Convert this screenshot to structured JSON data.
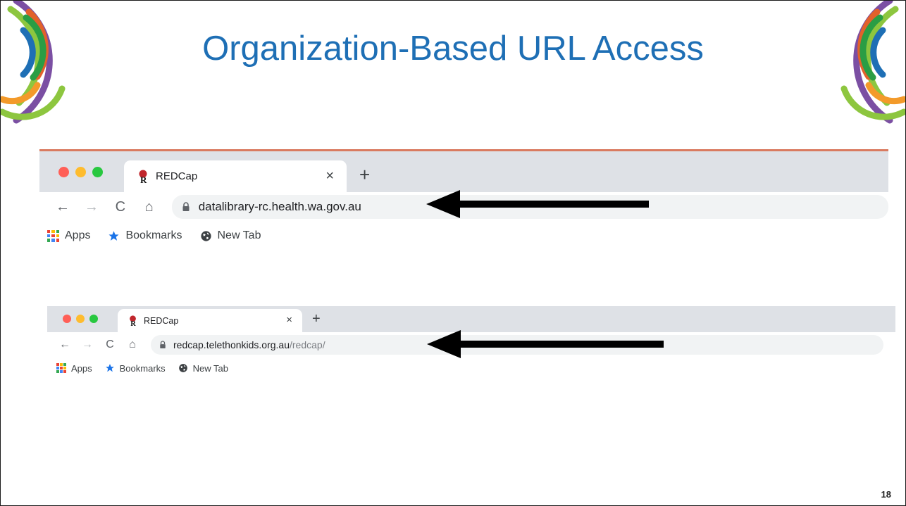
{
  "slide": {
    "title": "Organization-Based URL Access",
    "page_number": "18",
    "decor_colors": [
      "#7b4fa3",
      "#e2612b",
      "#2a9d44",
      "#f39a2a",
      "#1e6fb5",
      "#8dc63f"
    ]
  },
  "browser1": {
    "traffic_lights": [
      "#ff5f57",
      "#febc2e",
      "#28c840"
    ],
    "tab": {
      "title": "REDCap",
      "favicon": "redcap-logo-icon",
      "close": "×"
    },
    "new_tab": "+",
    "nav": {
      "back": "←",
      "forward": "→",
      "reload": "C",
      "home": "⌂"
    },
    "lock_icon": "lock-icon",
    "url": {
      "host": "datalibrary-rc.health.wa.gov.au",
      "path": ""
    },
    "bookmarks": [
      {
        "label": "Apps",
        "icon": "apps-grid-icon"
      },
      {
        "label": "Bookmarks",
        "icon": "star-icon"
      },
      {
        "label": "New Tab",
        "icon": "globe-icon"
      }
    ]
  },
  "browser2": {
    "traffic_lights": [
      "#ff5f57",
      "#febc2e",
      "#28c840"
    ],
    "tab": {
      "title": "REDCap",
      "favicon": "redcap-logo-icon",
      "close": "×"
    },
    "new_tab": "+",
    "nav": {
      "back": "←",
      "forward": "→",
      "reload": "C",
      "home": "⌂"
    },
    "lock_icon": "lock-icon",
    "url": {
      "host": "redcap.telethonkids.org.au",
      "path": "/redcap/"
    },
    "bookmarks": [
      {
        "label": "Apps",
        "icon": "apps-grid-icon"
      },
      {
        "label": "Bookmarks",
        "icon": "star-icon"
      },
      {
        "label": "New Tab",
        "icon": "globe-icon"
      }
    ]
  },
  "annotations": {
    "arrow_color": "#000000"
  }
}
